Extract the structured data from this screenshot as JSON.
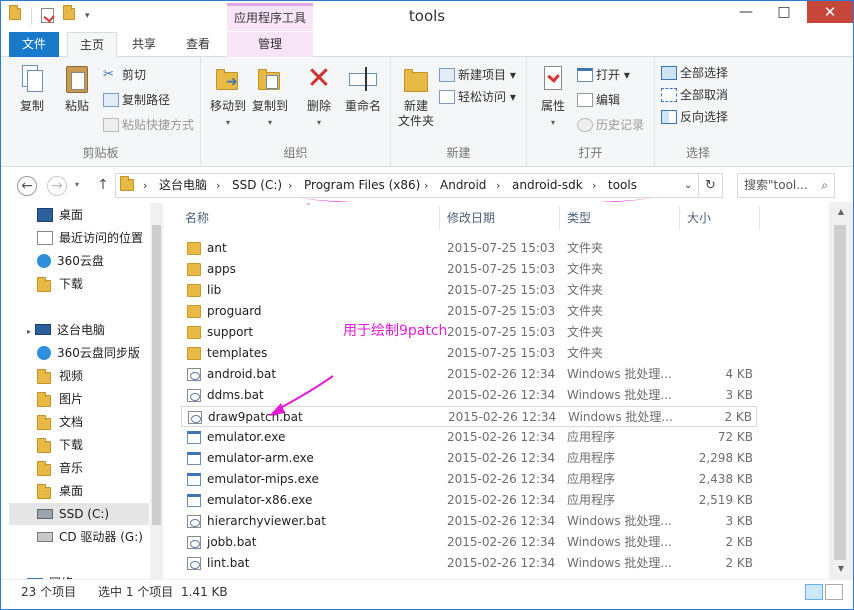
{
  "window": {
    "title": "tools",
    "context_tab_header": "应用程序工具",
    "controls": {
      "minimize": "—",
      "maximize": "□",
      "close": "✕"
    }
  },
  "tabs": [
    {
      "label": "文件"
    },
    {
      "label": "主页"
    },
    {
      "label": "共享"
    },
    {
      "label": "查看"
    },
    {
      "label": "管理"
    }
  ],
  "ribbon": {
    "groups": {
      "clipboard": {
        "label": "剪贴板",
        "copy": "复制",
        "paste": "粘贴",
        "cut": "剪切",
        "copy_path": "复制路径",
        "paste_shortcut": "粘贴快捷方式"
      },
      "organize": {
        "label": "组织",
        "move_to": "移动到",
        "copy_to": "复制到",
        "delete": "删除",
        "rename": "重命名"
      },
      "new": {
        "label": "新建",
        "new_folder_1": "新建",
        "new_folder_2": "文件夹",
        "new_item": "新建项目 ▾",
        "easy_access": "轻松访问 ▾"
      },
      "open": {
        "label": "打开",
        "properties": "属性",
        "open": "打开 ▾",
        "edit": "编辑",
        "history": "历史记录"
      },
      "select": {
        "label": "选择",
        "select_all": "全部选择",
        "select_none": "全部取消",
        "invert": "反向选择"
      }
    }
  },
  "address": {
    "crumbs": [
      "这台电脑",
      "SSD (C:)",
      "Program Files (x86)",
      "Android",
      "android-sdk",
      "tools"
    ],
    "search_placeholder": "搜索\"tool...",
    "nav": {
      "back": "←",
      "forward": "→",
      "up": "↑"
    }
  },
  "navpane": {
    "items": [
      "桌面",
      "最近访问的位置",
      "360云盘",
      "下载",
      "这台电脑",
      "360云盘同步版",
      "视频",
      "图片",
      "文档",
      "下载",
      "音乐",
      "桌面",
      "SSD (C:)",
      "CD 驱动器 (G:)",
      "网络"
    ]
  },
  "columns": {
    "name": "名称",
    "date": "修改日期",
    "type": "类型",
    "size": "大小"
  },
  "files": [
    {
      "name": "ant",
      "date": "2015-07-25 15:03",
      "type": "文件夹",
      "size": "",
      "kind": "folder"
    },
    {
      "name": "apps",
      "date": "2015-07-25 15:03",
      "type": "文件夹",
      "size": "",
      "kind": "folder"
    },
    {
      "name": "lib",
      "date": "2015-07-25 15:03",
      "type": "文件夹",
      "size": "",
      "kind": "folder"
    },
    {
      "name": "proguard",
      "date": "2015-07-25 15:03",
      "type": "文件夹",
      "size": "",
      "kind": "folder"
    },
    {
      "name": "support",
      "date": "2015-07-25 15:03",
      "type": "文件夹",
      "size": "",
      "kind": "folder"
    },
    {
      "name": "templates",
      "date": "2015-07-25 15:03",
      "type": "文件夹",
      "size": "",
      "kind": "folder"
    },
    {
      "name": "android.bat",
      "date": "2015-02-26 12:34",
      "type": "Windows 批处理...",
      "size": "4 KB",
      "kind": "bat"
    },
    {
      "name": "ddms.bat",
      "date": "2015-02-26 12:34",
      "type": "Windows 批处理...",
      "size": "3 KB",
      "kind": "bat"
    },
    {
      "name": "draw9patch.bat",
      "date": "2015-02-26 12:34",
      "type": "Windows 批处理...",
      "size": "2 KB",
      "kind": "bat"
    },
    {
      "name": "emulator.exe",
      "date": "2015-02-26 12:34",
      "type": "应用程序",
      "size": "72 KB",
      "kind": "exe"
    },
    {
      "name": "emulator-arm.exe",
      "date": "2015-02-26 12:34",
      "type": "应用程序",
      "size": "2,298 KB",
      "kind": "exe"
    },
    {
      "name": "emulator-mips.exe",
      "date": "2015-02-26 12:34",
      "type": "应用程序",
      "size": "2,438 KB",
      "kind": "exe"
    },
    {
      "name": "emulator-x86.exe",
      "date": "2015-02-26 12:34",
      "type": "应用程序",
      "size": "2,519 KB",
      "kind": "exe"
    },
    {
      "name": "hierarchyviewer.bat",
      "date": "2015-02-26 12:34",
      "type": "Windows 批处理...",
      "size": "3 KB",
      "kind": "bat"
    },
    {
      "name": "jobb.bat",
      "date": "2015-02-26 12:34",
      "type": "Windows 批处理...",
      "size": "2 KB",
      "kind": "bat"
    },
    {
      "name": "lint.bat",
      "date": "2015-02-26 12:34",
      "type": "Windows 批处理...",
      "size": "2 KB",
      "kind": "bat"
    }
  ],
  "annotation": {
    "text": "用于绘制9patch",
    "color": "#e31bd6"
  },
  "status": {
    "count": "23 个项目",
    "selected": "选中 1 个项目",
    "size": "1.41 KB"
  },
  "colors": {
    "accent": "#1979ca",
    "annotation": "#e31bd6",
    "close": "#c7463a"
  }
}
